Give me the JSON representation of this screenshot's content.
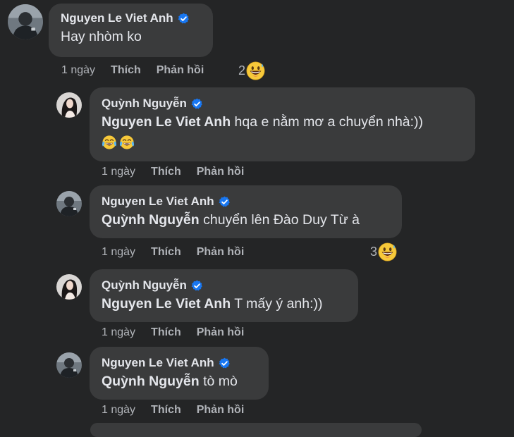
{
  "comments": [
    {
      "author": "Nguyen Le Viet Anh",
      "mention": "",
      "text": "Hay nhòm ko",
      "time": "1 ngày",
      "like": "Thích",
      "reply": "Phản hồi",
      "reaction_count": "2",
      "reaction_icon": "grinning-sweat-emoji"
    },
    {
      "author": "Quỳnh Nguyễn",
      "mention": "Nguyen Le Viet Anh",
      "text": "hqa e nằm mơ a chuyển nhà:))",
      "emojis": [
        "tears-of-joy-emoji",
        "tears-of-joy-emoji"
      ],
      "time": "1 ngày",
      "like": "Thích",
      "reply": "Phản hồi"
    },
    {
      "author": "Nguyen Le Viet Anh",
      "mention": "Quỳnh Nguyễn",
      "text": "chuyển lên Đào Duy Từ à",
      "time": "1 ngày",
      "like": "Thích",
      "reply": "Phản hồi",
      "reaction_count": "3",
      "reaction_icon": "grinning-sweat-emoji"
    },
    {
      "author": "Quỳnh Nguyễn",
      "mention": "Nguyen Le Viet Anh",
      "text": "T mấy ý anh:))",
      "time": "1 ngày",
      "like": "Thích",
      "reply": "Phản hồi"
    },
    {
      "author": "Nguyen Le Viet Anh",
      "mention": "Quỳnh Nguyễn",
      "text": "tò mò",
      "time": "1 ngày",
      "like": "Thích",
      "reply": "Phản hồi"
    }
  ],
  "colors": {
    "background": "#242526",
    "bubble": "#3a3b3c",
    "text": "#e4e6eb",
    "secondary": "#b0b3b8",
    "verified": "#1877f2"
  }
}
